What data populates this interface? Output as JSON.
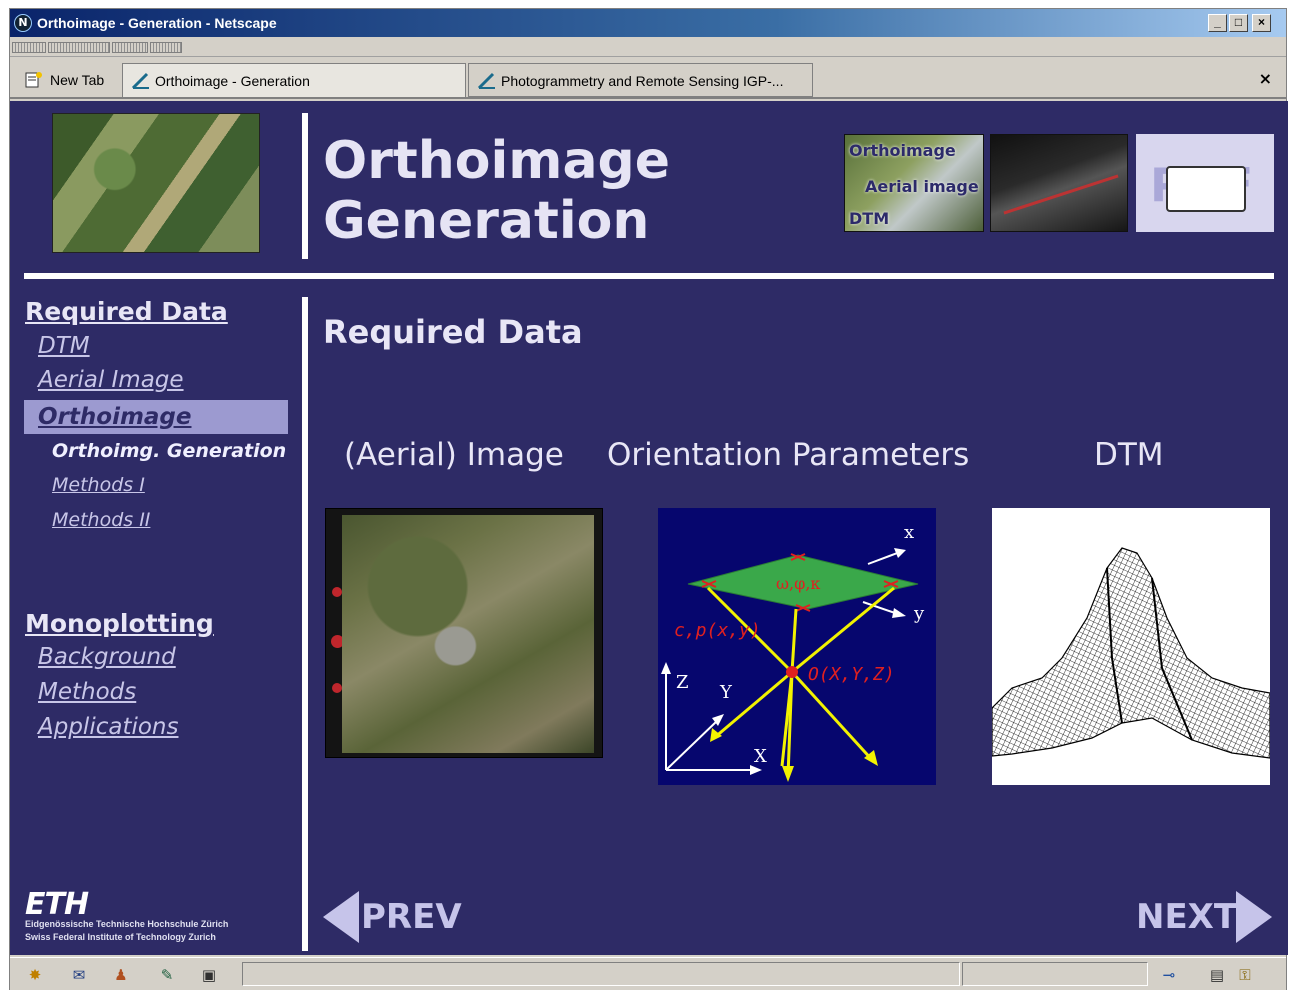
{
  "window": {
    "title": "Orthoimage - Generation - Netscape",
    "controls": {
      "minimize": "_",
      "maximize": "□",
      "close": "×"
    }
  },
  "tabs": [
    {
      "label": "New Tab",
      "icon": "new-tab-icon"
    },
    {
      "label": "Orthoimage - Generation",
      "icon": "pen-icon",
      "active": true
    },
    {
      "label": "Photogrammetry and Remote Sensing IGP-...",
      "icon": "pen-icon"
    }
  ],
  "tab_close": "×",
  "header": {
    "title_line1": "Orthoimage",
    "title_line2": "Generation",
    "thumb_labels": {
      "orthoimage": "Orthoimage",
      "aerial": "Aerial image",
      "dtm": "DTM"
    },
    "pdf_label": "PDF"
  },
  "sidebar": {
    "section1": {
      "heading": "Required Data",
      "items": [
        {
          "label": "DTM"
        },
        {
          "label": "Aerial Image"
        },
        {
          "label": "Orthoimage"
        }
      ],
      "subitems": [
        {
          "label": "Orthoimg. Generation"
        },
        {
          "label": "Methods I"
        },
        {
          "label": "Methods II"
        }
      ]
    },
    "section2": {
      "heading": "Monoplotting",
      "items": [
        {
          "label": "Background"
        },
        {
          "label": "Methods"
        },
        {
          "label": "Applications"
        }
      ]
    }
  },
  "main": {
    "section_title": "Required Data",
    "columns": [
      {
        "label": "(Aerial) Image"
      },
      {
        "label": "Orientation Parameters"
      },
      {
        "label": "DTM"
      }
    ],
    "orientation_diagram": {
      "axis_x_top": "x",
      "axis_y_top": "y",
      "angles": "ω,φ,κ",
      "camera_const": "c,p(x,y)",
      "projection_center": "O(X,Y,Z)",
      "axis_Z": "Z",
      "axis_Y": "Y",
      "axis_X": "X"
    }
  },
  "footer": {
    "logo": "ETH",
    "line1": "Eidgenössische Technische Hochschule Zürich",
    "line2": "Swiss Federal Institute of Technology Zurich",
    "prev": "PREV",
    "next": "NEXT"
  },
  "colors": {
    "page_bg": "#2e2b66",
    "text_light": "#e8e6f6",
    "highlight": "#9c9ad0",
    "titlebar": "#0a246a"
  }
}
